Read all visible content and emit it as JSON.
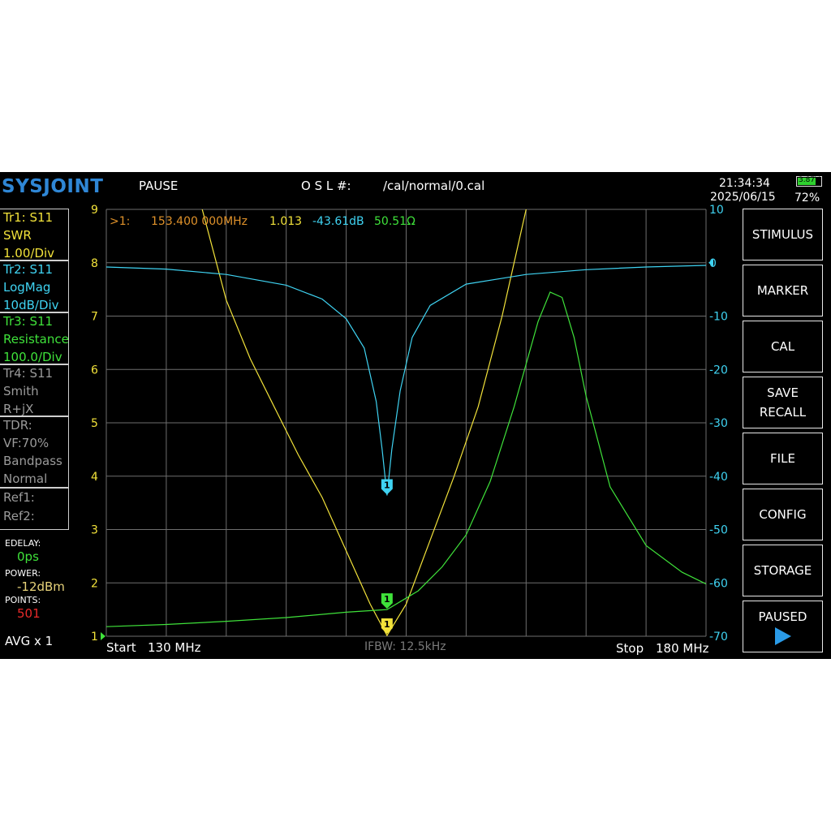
{
  "header": {
    "logo": "SYSJOINT",
    "state": "PAUSE",
    "osl_label": "O S L #:",
    "cal_file": "/cal/normal/0.cal",
    "time": "21:34:34",
    "date": "2025/06/15",
    "battery_voltage": "3.87V",
    "battery_percent": "72%"
  },
  "traces": [
    {
      "line1": "Tr1:  S11",
      "line2": "SWR",
      "line3": "1.00/Div",
      "color": "#f2e23a"
    },
    {
      "line1": "Tr2:  S11",
      "line2": "LogMag",
      "line3": "10dB/Div",
      "color": "#3fd3f2"
    },
    {
      "line1": "Tr3:  S11",
      "line2": "Resistance",
      "line3": "100.0/Div",
      "color": "#3fe23a"
    },
    {
      "line1": "Tr4:  S11",
      "line2": "Smith",
      "line3": "R+jX",
      "color": "#9a9a9a"
    }
  ],
  "tdr": {
    "title": "TDR:",
    "vf": "VF:70%",
    "mode": "Bandpass",
    "window": "Normal"
  },
  "refs": {
    "ref1": "Ref1:",
    "ref2": "Ref2:"
  },
  "settings": {
    "edelay_label": "EDELAY:",
    "edelay_value": "0ps",
    "power_label": "POWER:",
    "power_value": "-12dBm",
    "points_label": "POINTS:",
    "points_value": "501",
    "avg": "AVG x 1"
  },
  "marker_readout": {
    "id": ">1:",
    "freq": "153.400 000MHz",
    "swr": "1.013",
    "logmag": "-43.61dB",
    "resistance": "50.51Ω"
  },
  "footer": {
    "start_label": "Start",
    "start_value": "130 MHz",
    "ifbw": "IFBW: 12.5kHz",
    "stop_label": "Stop",
    "stop_value": "180 MHz"
  },
  "menu": {
    "stimulus": "STIMULUS",
    "marker": "MARKER",
    "cal": "CAL",
    "save": "SAVE",
    "recall": "RECALL",
    "file": "FILE",
    "config": "CONFIG",
    "storage": "STORAGE",
    "paused": "PAUSED"
  },
  "colors": {
    "swr": "#f2e23a",
    "logmag": "#3fd3f2",
    "resistance": "#3fe23a",
    "marker_freq": "#e0922a",
    "grid": "#6e6e6e",
    "logo": "#2f87d6",
    "play": "#2a9be8"
  },
  "chart_data": {
    "type": "line",
    "x_range_mhz": [
      130,
      180
    ],
    "left_axis": {
      "ticks": [
        "9",
        "8",
        "7",
        "6",
        "5",
        "4",
        "3",
        "2",
        "1"
      ],
      "ylim": [
        1,
        9
      ]
    },
    "right_axis": {
      "ticks": [
        "10",
        "0",
        "-10",
        "-20",
        "-30",
        "-40",
        "-50",
        "-60",
        "-70"
      ],
      "ylim": [
        -70,
        10
      ]
    },
    "marker": {
      "label": "1",
      "x_mhz": 153.4
    },
    "series": [
      {
        "name": "SWR",
        "axis": "left",
        "x": [
          130,
          132,
          134,
          136,
          138,
          140,
          142,
          144,
          146,
          148,
          150,
          152,
          153.4,
          155,
          157,
          159,
          161,
          163,
          165,
          167,
          169,
          171,
          173,
          175,
          177,
          180
        ],
        "y": [
          12,
          12,
          12,
          12,
          9,
          7.3,
          6.2,
          5.3,
          4.4,
          3.6,
          2.6,
          1.6,
          1.013,
          1.6,
          2.8,
          4,
          5.3,
          7,
          9,
          12,
          12,
          12,
          12,
          12,
          12,
          12
        ]
      },
      {
        "name": "LogMag",
        "axis": "right",
        "x": [
          130,
          135,
          140,
          145,
          148,
          150,
          151.5,
          152.5,
          153,
          153.4,
          153.8,
          154.5,
          155.5,
          157,
          160,
          165,
          170,
          175,
          180
        ],
        "y": [
          -0.8,
          -1.2,
          -2.2,
          -4.2,
          -6.8,
          -10.5,
          -16,
          -26,
          -35,
          -43.6,
          -35,
          -24,
          -14,
          -8,
          -4,
          -2.2,
          -1.3,
          -0.8,
          -0.5
        ]
      },
      {
        "name": "Resistance",
        "axis": "left",
        "x": [
          130,
          135,
          140,
          145,
          150,
          153.4,
          156,
          158,
          160,
          162,
          164,
          165,
          166,
          167,
          168,
          169,
          170,
          172,
          175,
          178,
          180
        ],
        "y": [
          1.18,
          1.22,
          1.28,
          1.35,
          1.45,
          1.5,
          1.85,
          2.3,
          2.9,
          3.9,
          5.3,
          6.1,
          6.9,
          7.45,
          7.35,
          6.6,
          5.5,
          3.8,
          2.7,
          2.2,
          1.98
        ]
      }
    ]
  }
}
